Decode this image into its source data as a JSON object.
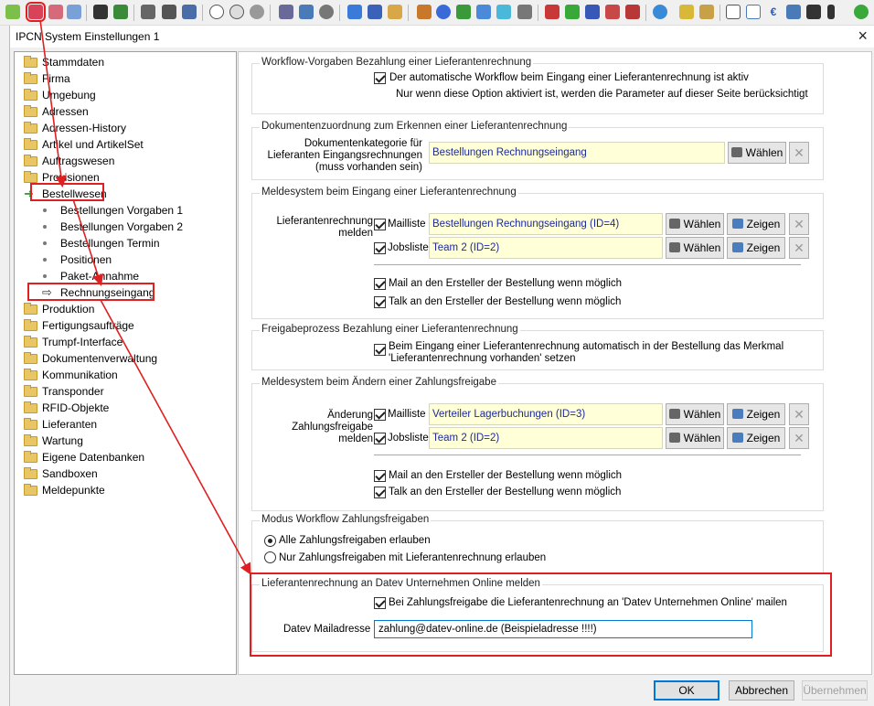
{
  "window": {
    "title": "IPCN System Einstellungen 1",
    "close": "×"
  },
  "tree": {
    "items": [
      {
        "label": "Stammdaten",
        "kind": "folder"
      },
      {
        "label": "Firma",
        "kind": "folder"
      },
      {
        "label": "Umgebung",
        "kind": "folder"
      },
      {
        "label": "Adressen",
        "kind": "folder"
      },
      {
        "label": "Adressen-History",
        "kind": "folder"
      },
      {
        "label": "Artikel und ArtikelSet",
        "kind": "folder"
      },
      {
        "label": "Auftragswesen",
        "kind": "folder"
      },
      {
        "label": "Provisionen",
        "kind": "folder"
      },
      {
        "label": "Bestellwesen",
        "kind": "expanded"
      },
      {
        "label": "Bestellungen Vorgaben 1",
        "kind": "child"
      },
      {
        "label": "Bestellungen Vorgaben 2",
        "kind": "child"
      },
      {
        "label": "Bestellungen Termin",
        "kind": "child"
      },
      {
        "label": "Positionen",
        "kind": "child"
      },
      {
        "label": "Paket-Annahme",
        "kind": "child"
      },
      {
        "label": "Rechnungseingang",
        "kind": "selected"
      },
      {
        "label": "Produktion",
        "kind": "folder"
      },
      {
        "label": "Fertigungsaufträge",
        "kind": "folder"
      },
      {
        "label": "Trumpf-Interface",
        "kind": "folder"
      },
      {
        "label": "Dokumentenverwaltung",
        "kind": "folder"
      },
      {
        "label": "Kommunikation",
        "kind": "folder"
      },
      {
        "label": "Transponder",
        "kind": "folder"
      },
      {
        "label": "RFID-Objekte",
        "kind": "folder"
      },
      {
        "label": "Lieferanten",
        "kind": "folder"
      },
      {
        "label": "Wartung",
        "kind": "folder"
      },
      {
        "label": "Eigene Datenbanken",
        "kind": "folder"
      },
      {
        "label": "Sandboxen",
        "kind": "folder"
      },
      {
        "label": "Meldepunkte",
        "kind": "folder"
      }
    ]
  },
  "workflow": {
    "title": "Workflow-Vorgaben Bezahlung einer Lieferantenrechnung",
    "checkbox": "Der automatische Workflow beim Eingang einer Lieferantenrechnung ist aktiv",
    "checked": true,
    "note": "Nur wenn diese Option aktiviert ist, werden die Parameter auf dieser Seite berücksichtigt"
  },
  "dokument": {
    "title": "Dokumentenzuordnung zum Erkennen einer Lieferantenrechnung",
    "label_1": "Dokumentenkategorie für",
    "label_2": "Lieferanten Eingangsrechnungen",
    "label_3": "(muss vorhanden sein)",
    "value": "Bestellungen Rechnungseingang",
    "choose": "Wählen"
  },
  "meld1": {
    "title": "Meldesystem beim Eingang einer Lieferantenrechnung",
    "label_1": "Lieferantenrechnung",
    "label_2": "melden",
    "mail_label": "Mailliste",
    "mail_value": "Bestellungen Rechnungseingang (ID=4)",
    "jobs_label": "Jobsliste",
    "jobs_value": "Team 2 (ID=2)",
    "choose": "Wählen",
    "show": "Zeigen",
    "opt_mail": "Mail an den Ersteller der  Bestellung wenn möglich",
    "opt_talk": "Talk an den Ersteller der  Bestellung wenn möglich"
  },
  "freigabe": {
    "title": "Freigabeprozess Bezahlung einer Lieferantenrechnung",
    "line_1": "Beim Eingang einer Lieferantenrechnung automatisch in der Bestellung das Merkmal",
    "line_2": "'Lieferantenrechnung vorhanden' setzen"
  },
  "meld2": {
    "title": "Meldesystem beim Ändern einer Zahlungsfreigabe",
    "label_1": "Änderung",
    "label_2": "Zahlungsfreigabe",
    "label_3": "melden",
    "mail_label": "Mailliste",
    "mail_value": "Verteiler Lagerbuchungen (ID=3)",
    "jobs_label": "Jobsliste",
    "jobs_value": "Team 2 (ID=2)",
    "choose": "Wählen",
    "show": "Zeigen",
    "opt_mail": "Mail an den Ersteller der  Bestellung wenn möglich",
    "opt_talk": "Talk an den Ersteller der  Bestellung wenn möglich"
  },
  "modus": {
    "title": "Modus Workflow Zahlungsfreigaben",
    "opt_all": "Alle Zahlungsfreigaben erlauben",
    "opt_only": "Nur Zahlungsfreigaben mit Lieferantenrechnung erlauben",
    "selected": "opt_all"
  },
  "datev": {
    "title": "Lieferantenrechnung an Datev Unternehmen Online melden",
    "checkbox": "Bei Zahlungsfreigabe die Lieferantenrechnung an 'Datev Unternehmen Online' mailen",
    "mail_label": "Datev Mailadresse",
    "mail_value": "zahlung@datev-online.de  (Beispieladresse !!!!)"
  },
  "footer": {
    "ok": "OK",
    "cancel": "Abbrechen",
    "apply": "Übernehmen"
  },
  "colors": {
    "highlight": "#e02020",
    "field_bg": "#ffffd8",
    "field_text": "#1c2a9e"
  }
}
